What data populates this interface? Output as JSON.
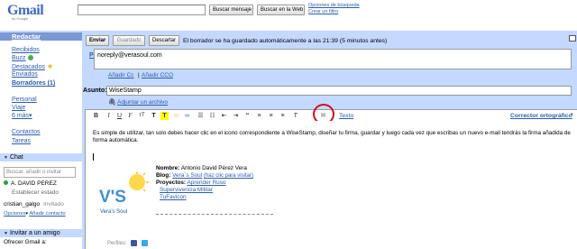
{
  "brand": {
    "logo": "Gmail",
    "by": "by Google"
  },
  "search": {
    "mail_button": "Buscar mensaje",
    "web_button": "Buscar en la Web",
    "options_link": "Opciones de búsqueda",
    "filter_link": "Crear un filtro"
  },
  "nav": {
    "compose": "Redactar",
    "items": [
      {
        "label": "Recibidos"
      },
      {
        "label": "Buzz"
      },
      {
        "label": "Destacados"
      },
      {
        "label": "Enviados"
      },
      {
        "label": "Borradores (1)"
      },
      {
        "label": "Personal"
      },
      {
        "label": "Viaje"
      },
      {
        "label": "6 más▾"
      },
      {
        "label": "Contactos"
      },
      {
        "label": "Tareas"
      }
    ],
    "chat_header": "Chat",
    "chat_search_placeholder": "Buscar, añadir o invitar",
    "chat_user": "A. DAVID PEREZ",
    "chat_status": "Establecer estado",
    "contact_name": "cristian_galgo",
    "contact_status": "Invitado",
    "options_link": "Opciones",
    "add_contact": "Añadir contacto",
    "invite_header": "Invitar a un amigo",
    "invite_text": "Ofrecer Gmail a:"
  },
  "compose": {
    "send_button": "Enviar",
    "saved_button": "Guardado",
    "discard_button": "Descartar",
    "status_text": "El borrador se ha guardado automáticamente a las 21:39 (5 minutos antes)",
    "to_label": "Para:",
    "to_value": "noreply@verasoul.com",
    "add_cc": "Añadir Cc",
    "add_bcc": "Añadir CCO",
    "subject_label": "Asunto:",
    "subject_value": "WiseStamp",
    "attach_link": "Adjuntar un archivo",
    "text_link": "Texto",
    "spellcheck": "Corrector ortográfico",
    "body_intro": "Es simple de utilizar, tan solo debes hacer clic en el icono correspondiente a WiseStamp, diseñar tu firma, guardar y luego cada vez que escribas un nuevo e-mail tendrás la firma añadida de forma automática.",
    "signature": {
      "logo_text": "V'S",
      "logo_caption": "Vera's Soul",
      "name_label": "Nombre:",
      "name_value": "Antonio David Pérez Vera",
      "blog_label": "Blog:",
      "blog_value": "Vera´s Soul",
      "blog_hint": "(haz clic para visitar)",
      "projects_label": "Proyectos:",
      "project_1": "Aprender Ruso",
      "project_2": "Supervivencia Militar",
      "project_3": "TuFavicon"
    },
    "perfiles": "Perfiles:"
  },
  "colors": {
    "nav_bg": "#c3d9ff",
    "compose_bg": "#7a97d6",
    "highlight_circle": "#d0101a",
    "link": "#2a5db0"
  }
}
